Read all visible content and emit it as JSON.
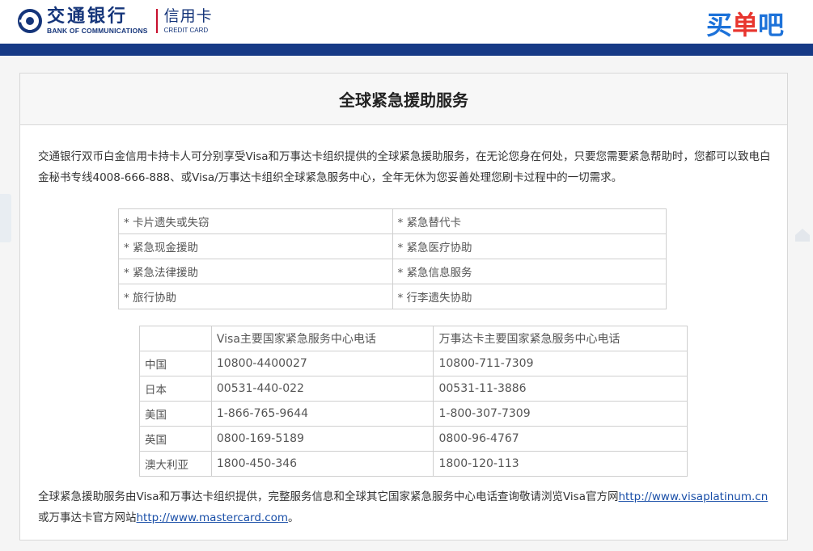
{
  "header": {
    "bank_name_cn": "交通银行",
    "bank_name_en": "BANK OF COMMUNICATIONS",
    "card_name_cn": "信用卡",
    "card_name_en": "CREDIT CARD",
    "app_logo_a": "买",
    "app_logo_b": "单",
    "app_logo_c": "吧"
  },
  "page": {
    "title": "全球紧急援助服务",
    "intro": "交通银行双币白金信用卡持卡人可分别享受Visa和万事达卡组织提供的全球紧急援助服务，在无论您身在何处，只要您需要紧急帮助时，您都可以致电白金秘书专线4008-666-888、或Visa/万事达卡组织全球紧急服务中心，全年无休为您妥善处理您刷卡过程中的一切需求。"
  },
  "services": [
    [
      "* 卡片遗失或失窃",
      "* 紧急替代卡"
    ],
    [
      "* 紧急现金援助",
      "* 紧急医疗协助"
    ],
    [
      "* 紧急法律援助",
      "* 紧急信息服务"
    ],
    [
      "* 旅行协助",
      "* 行李遗失协助"
    ]
  ],
  "phones": {
    "headers": [
      "",
      "Visa主要国家紧急服务中心电话",
      "万事达卡主要国家紧急服务中心电话"
    ],
    "rows": [
      [
        "中国",
        "10800-4400027",
        "10800-711-7309"
      ],
      [
        "日本",
        "00531-440-022",
        "00531-11-3886"
      ],
      [
        "美国",
        "1-866-765-9644",
        "1-800-307-7309"
      ],
      [
        "英国",
        "0800-169-5189",
        "0800-96-4767"
      ],
      [
        "澳大利亚",
        "1800-450-346",
        "1800-120-113"
      ]
    ]
  },
  "footer": {
    "text_before": "全球紧急援助服务由Visa和万事达卡组织提供，完整服务信息和全球其它国家紧急服务中心电话查询敬请浏览Visa官方网",
    "visa_link": "http://www.visaplatinum.cn",
    "text_middle": "或万事达卡官方网站",
    "mc_link": "http://www.mastercard.com",
    "text_end": "。"
  },
  "colors": {
    "brand_navy": "#163a86",
    "brand_red": "#c8102e",
    "app_blue": "#1d72d9"
  }
}
